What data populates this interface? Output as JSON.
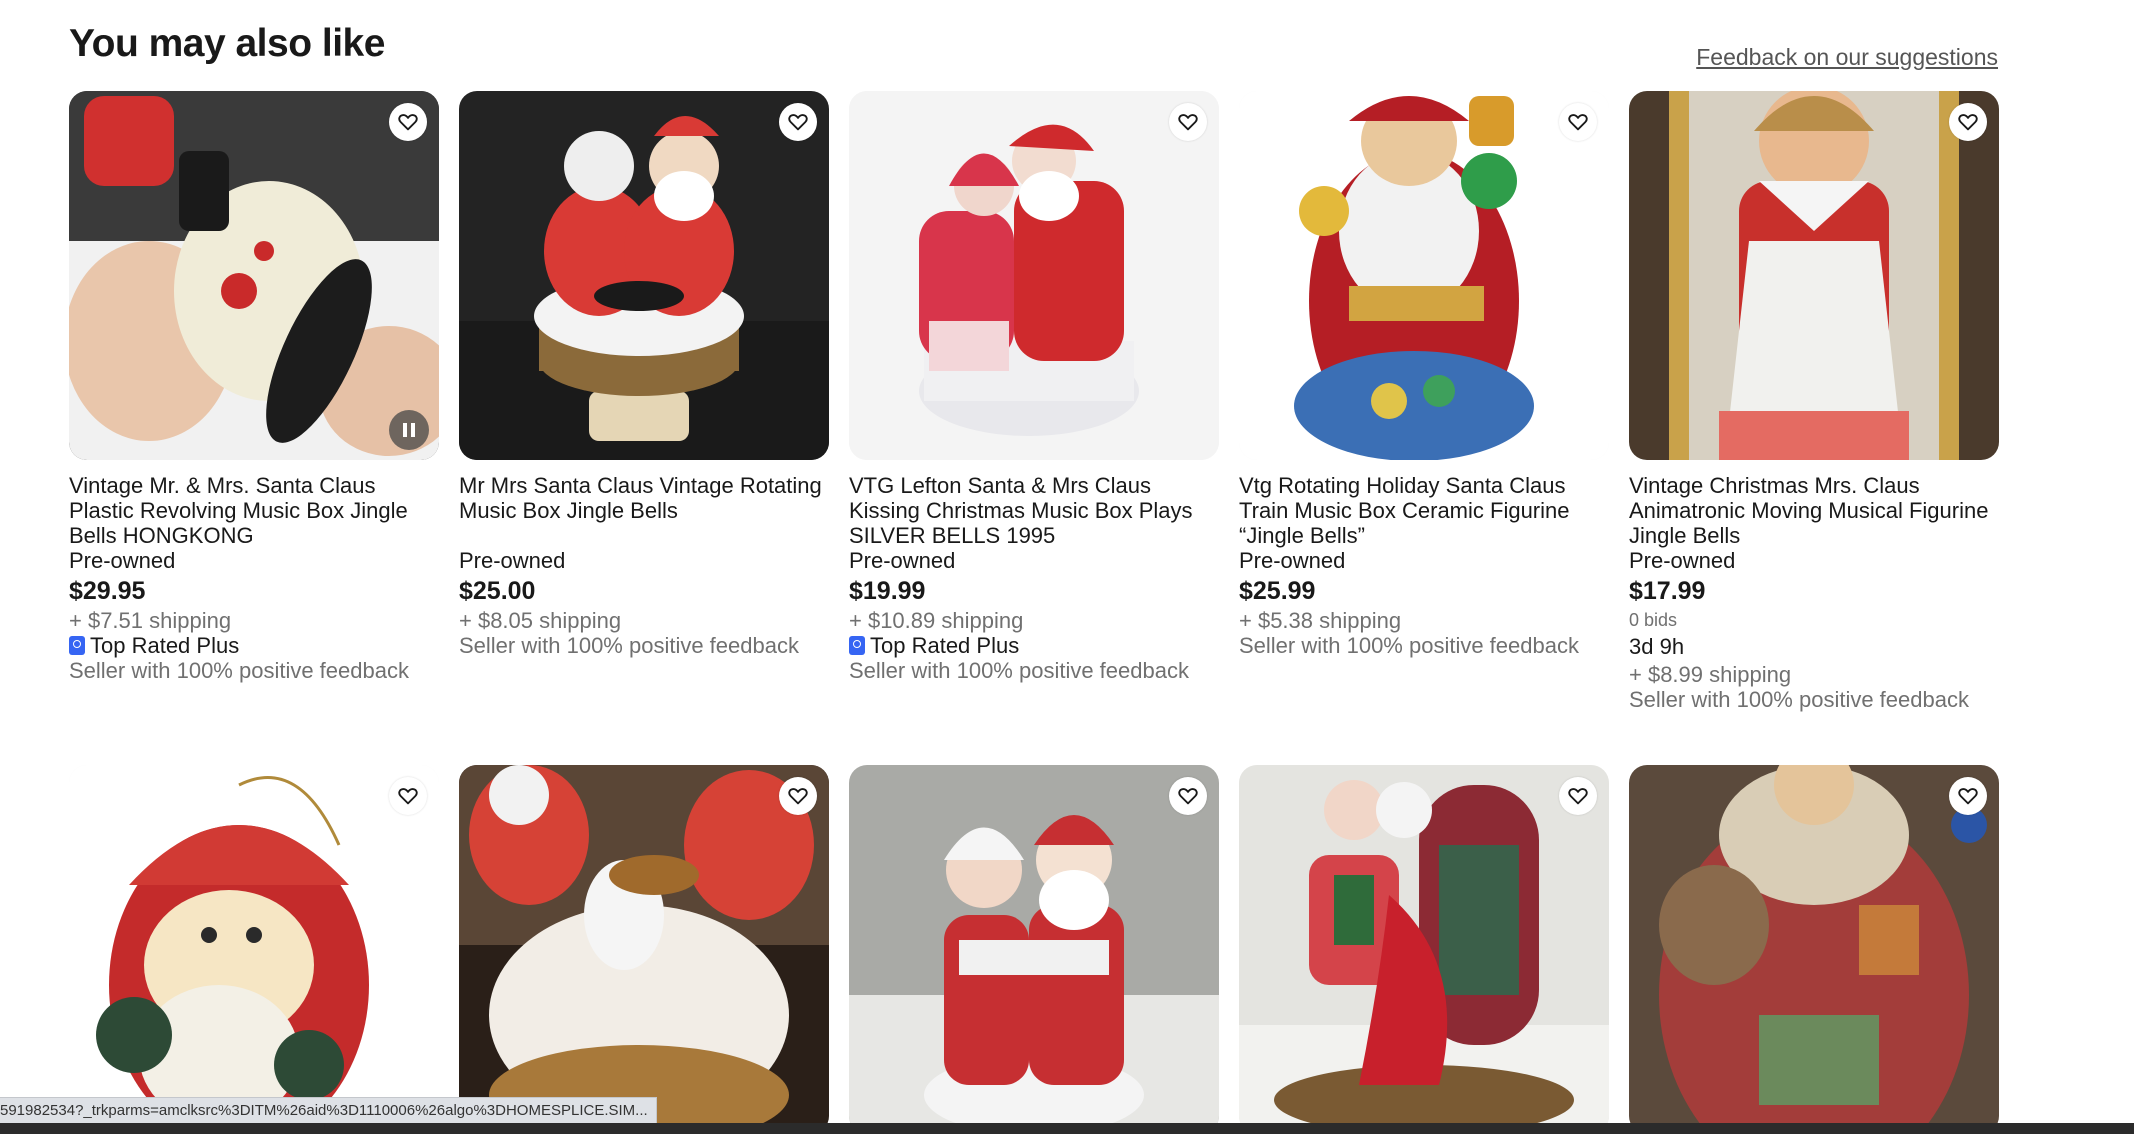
{
  "section": {
    "title": "You may also like",
    "feedback_link": "Feedback on our suggestions"
  },
  "row1": [
    {
      "title": "Vintage Mr. & Mrs. Santa Claus Plastic Revolving Music Box Jingle Bells HONGKONG",
      "condition": "Pre-owned",
      "price": "$29.95",
      "shipping": "+ $7.51 shipping",
      "badge": "Top Rated Plus",
      "seller": "Seller with 100% positive feedback",
      "has_video": true
    },
    {
      "title": "Mr Mrs Santa Claus Vintage Rotating Music Box Jingle Bells",
      "condition": "Pre-owned",
      "price": "$25.00",
      "shipping": "+ $8.05 shipping",
      "seller": "Seller with 100% positive feedback"
    },
    {
      "title": "VTG Lefton Santa & Mrs Claus Kissing Christmas Music Box Plays SILVER BELLS 1995",
      "condition": "Pre-owned",
      "price": "$19.99",
      "shipping": "+ $10.89 shipping",
      "badge": "Top Rated Plus",
      "seller": "Seller with 100% positive feedback"
    },
    {
      "title": "Vtg Rotating Holiday Santa Claus Train Music Box Ceramic Figurine “Jingle Bells”",
      "condition": "Pre-owned",
      "price": "$25.99",
      "shipping": "+ $5.38 shipping",
      "seller": "Seller with 100% positive feedback"
    },
    {
      "title": "Vintage Christmas Mrs. Claus Animatronic Moving Musical Figurine Jingle Bells",
      "condition": "Pre-owned",
      "price": "$17.99",
      "bids": "0 bids",
      "time_left": "3d 9h",
      "shipping": "+ $8.99 shipping",
      "seller": "Seller with 100% positive feedback"
    }
  ],
  "icons": {
    "heart": "heart-outline-icon",
    "pause": "pause-icon",
    "badge": "top-rated-plus-icon"
  },
  "status_bar": {
    "url": "591982534?_trkparms=amclksrc%3DITM%26aid%3D1110006%26algo%3DHOMESPLICE.SIM..."
  },
  "colors": {
    "badge_blue": "#3665f3",
    "muted_text": "#707070"
  }
}
